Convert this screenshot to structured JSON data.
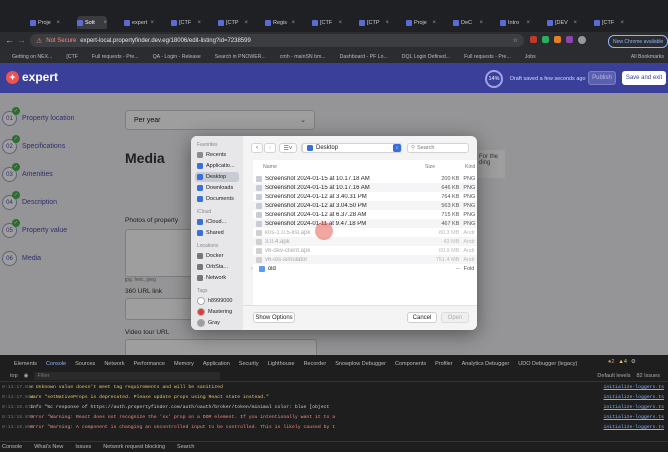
{
  "browser": {
    "tabs": [
      "Proje",
      "Sott",
      "expert",
      "[CTF",
      "[CTP",
      "Regis",
      "[CTF",
      "[CTP",
      "Proje",
      "DeC",
      "Intro",
      "[DEV",
      "[CTF"
    ],
    "url_security": "Not Secure",
    "url": "expert-local.propertyfinder.dev.eg/18006/edit-listing?id=7238599",
    "profile_label": "New Chrome available",
    "bookmarks": [
      "Getting on NEX...",
      "[CTF",
      "Full requests - Pre...",
      "QA - Login - Release",
      "Search in PNOWER...",
      "cmh - mainSN bm...",
      "Dashboard - PF Lo...",
      "DQL Login Defined...",
      "Full requests - Pre...",
      "Jobs",
      "All Bookmarks"
    ]
  },
  "app": {
    "logo": "expert",
    "progress": "14%",
    "draft_status": "Draft saved a few seconds ago",
    "publish_label": "Publish",
    "save_exit_label": "Save and exit"
  },
  "steps": [
    {
      "num": "01",
      "label": "Property location",
      "done": true
    },
    {
      "num": "02",
      "label": "Specifications",
      "done": true
    },
    {
      "num": "03",
      "label": "Amenities",
      "done": true
    },
    {
      "num": "04",
      "label": "Description",
      "done": true
    },
    {
      "num": "05",
      "label": "Property value",
      "done": true
    },
    {
      "num": "06",
      "label": "Media",
      "done": false
    }
  ],
  "form": {
    "period_value": "Per year",
    "section_title": "Media",
    "photos_label": "Photos of property",
    "photo_hint": "jpg, heic, jpeg",
    "url_360_label": "360 URL link",
    "video_label": "Video tour URL",
    "side_help": "For the ding"
  },
  "dialog": {
    "sidebar": {
      "favorites_header": "Favorites",
      "favorites": [
        {
          "label": "Recents",
          "icon": "clock-icon",
          "color": "#8a8a8a"
        },
        {
          "label": "Applicatio...",
          "icon": "apps-icon",
          "color": "#3a6fd8"
        },
        {
          "label": "Desktop",
          "icon": "desktop-icon",
          "color": "#3a6fd8",
          "selected": true
        },
        {
          "label": "Downloads",
          "icon": "downloads-icon",
          "color": "#3a6fd8"
        },
        {
          "label": "Documents",
          "icon": "documents-icon",
          "color": "#3a6fd8"
        }
      ],
      "icloud_header": "iCloud",
      "icloud": [
        {
          "label": "iCloud...",
          "icon": "cloud-icon",
          "color": "#3a6fd8"
        },
        {
          "label": "Shared",
          "icon": "shared-folder-icon",
          "color": "#3a6fd8"
        }
      ],
      "locations_header": "Locations",
      "locations": [
        {
          "label": "Docker",
          "icon": "drive-icon",
          "color": "#777777"
        },
        {
          "label": "OrbSta...",
          "icon": "drive-icon",
          "color": "#777777"
        },
        {
          "label": "Network",
          "icon": "network-icon",
          "color": "#777777"
        }
      ],
      "tags_header": "Tags",
      "tags": [
        {
          "label": "h8999000",
          "color": "#ffffff"
        },
        {
          "label": "Mastering",
          "color": "#e53935"
        },
        {
          "label": "Gray",
          "color": "#9e9e9e"
        }
      ]
    },
    "location": "Desktop",
    "search_placeholder": "Search",
    "columns": {
      "name": "Name",
      "size": "Size",
      "kind": "Kind"
    },
    "files": [
      {
        "name": "Screenshot 2024-01-15 at 10.17.18 AM",
        "size": "200 KB",
        "kind": "PNG",
        "dim": false
      },
      {
        "name": "Screenshot 2024-01-15 at 10.17.16 AM",
        "size": "646 KB",
        "kind": "PNG",
        "dim": false
      },
      {
        "name": "Screenshot 2024-01-12 at 3.40.31 PM",
        "size": "764 KB",
        "kind": "PNG",
        "dim": false
      },
      {
        "name": "Screenshot 2024-01-12 at 3.04.50 PM",
        "size": "563 KB",
        "kind": "PNG",
        "dim": false
      },
      {
        "name": "Screenshot 2024-01-12 at 6.37.28 AM",
        "size": "715 KB",
        "kind": "PNG",
        "dim": false
      },
      {
        "name": "Screenshot 2024-01-11 at 9.47.18 PM",
        "size": "467 KB",
        "kind": "PNG",
        "dim": false
      },
      {
        "name": "k0s-1.0.5-list.apk",
        "size": "80.3 MB",
        "kind": "Andr",
        "dim": true
      },
      {
        "name": "3.0.4.apk",
        "size": "43 MB",
        "kind": "Andr",
        "dim": true
      },
      {
        "name": "v6-dev-client.apk",
        "size": "60.9 MB",
        "kind": "Andr",
        "dim": true
      },
      {
        "name": "v6-ios-simulator",
        "size": "751.4 MB",
        "kind": "Andr",
        "dim": true
      },
      {
        "name": "old",
        "size": "--",
        "kind": "Fold",
        "dim": false,
        "folder": true
      }
    ],
    "show_options_label": "Show Options",
    "cancel_label": "Cancel",
    "open_label": "Open"
  },
  "devtools": {
    "tabs": [
      "Elements",
      "Console",
      "Sources",
      "Network",
      "Performance",
      "Memory",
      "Application",
      "Security",
      "Lighthouse",
      "Recorder",
      "Snowplow Debugger",
      "Components",
      "Profiler",
      "Analytics Debugger",
      "UDO Debugger (legacy)"
    ],
    "active_tab": "Console",
    "context": "top",
    "filter_placeholder": "Filter",
    "levels": "Default levels",
    "issues": "82 Issues",
    "logs": [
      {
        "ts": "0:11:17.843",
        "text": "▸ Unknown value doesn't meet tag requirements and will be sanitized",
        "link": "initialize-loggers.ts",
        "color": "#e8c66b"
      },
      {
        "ts": "0:11:17.843",
        "text": "warn \"setNativeProps is deprecated. Please update props using React state instead.\"",
        "link": "initialize-loggers.ts",
        "color": "#e8c66b"
      },
      {
        "ts": "0:11:18.673",
        "text": "info \"%c response of https://auth.propertyfinder.com/auth/oauth/broker/token/minimal color: blue [object",
        "link": "initialize-loggers.ts",
        "color": "#cfcfcf"
      },
      {
        "ts": "0:11:18.873",
        "text": "error \"Warning: React does not recognize the 'sx' prop on a DOM element. If you intentionally want it to a",
        "link": "initialize-loggers.ts",
        "color": "#f28b82"
      },
      {
        "ts": "0:11:18.890",
        "text": "error \"Warning: A component is changing an uncontrolled input to be controlled. This is likely caused by t",
        "link": "initialize-loggers.ts",
        "color": "#f28b82"
      }
    ],
    "bottom_tabs": [
      "Console",
      "What's New",
      "Issues",
      "Network request blocking",
      "Search"
    ]
  }
}
